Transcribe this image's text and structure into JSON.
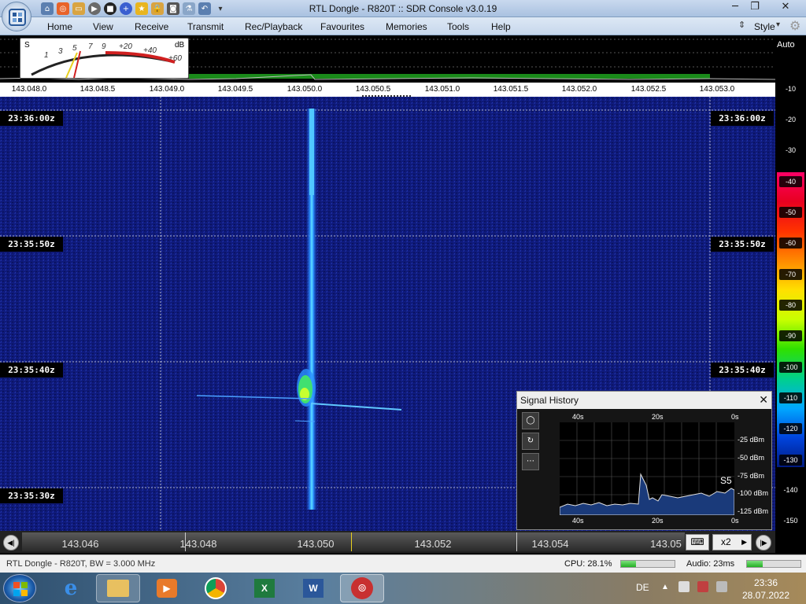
{
  "window": {
    "title": "RTL Dongle - R820T :: SDR Console v3.0.19",
    "minimize": "─",
    "maximize": "❐",
    "close": "✕"
  },
  "menu": {
    "items": [
      "Home",
      "View",
      "Receive",
      "Transmit",
      "Rec/Playback",
      "Favourites",
      "Memories",
      "Tools",
      "Help"
    ],
    "style": "Style"
  },
  "meter": {
    "s_label": "S",
    "db_label": "dB",
    "marks": [
      "1",
      "3",
      "5",
      "7",
      "9",
      "+20",
      "+40",
      "+60"
    ]
  },
  "freq_scale": {
    "labels": [
      "143.048.0",
      "143.048.5",
      "143.049.0",
      "143.049.5",
      "143.050.0",
      "143.050.5",
      "143.051.0",
      "143.051.5",
      "143.052.0",
      "143.052.5",
      "143.053.0"
    ]
  },
  "db_scale": {
    "auto": "Auto",
    "labels": [
      "-10",
      "-20",
      "-30",
      "-40",
      "-50",
      "-60",
      "-70",
      "-80",
      "-90",
      "-100",
      "-110",
      "-120",
      "-130",
      "-140",
      "-150"
    ]
  },
  "colors": {
    "waterfall_bg": "#0f1a7a",
    "accent": "#d43030"
  },
  "waterfall": {
    "timestamps": [
      "23:36:00z",
      "23:35:50z",
      "23:35:40z",
      "23:35:30z"
    ]
  },
  "signal_history": {
    "title": "Signal History",
    "close": "✕",
    "buttons": [
      "◯",
      "↻",
      "⋯"
    ],
    "x_labels": [
      "40s",
      "20s",
      "0s"
    ],
    "y_labels": [
      "-25 dBm",
      "-50 dBm",
      "-75 dBm",
      "-100 dBm",
      "-125 dBm"
    ],
    "s_reading": "S5"
  },
  "bottom_freq": {
    "labels": [
      "143.046",
      "143.048",
      "143.050",
      "143.052",
      "143.054",
      "143.05"
    ],
    "zoom": "x2"
  },
  "status": {
    "device": "RTL Dongle - R820T, BW = 3.000 MHz",
    "cpu": "CPU: 28.1%",
    "cpu_value": 28.1,
    "audio": "Audio: 23ms",
    "audio_value": 30
  },
  "taskbar": {
    "lang": "DE",
    "time": "23:36",
    "date": "28.07.2022"
  }
}
